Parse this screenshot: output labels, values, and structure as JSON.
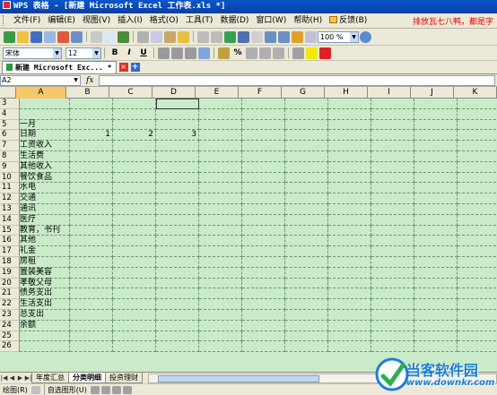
{
  "window": {
    "title": "WPS 表格 - [新建 Microsoft Excel 工作表.xls *]"
  },
  "menu": {
    "items": [
      "文件(F)",
      "编辑(E)",
      "视图(V)",
      "插入(I)",
      "格式(O)",
      "工具(T)",
      "数据(D)",
      "窗口(W)",
      "帮助(H)",
      "反馈(B)"
    ],
    "ad_text": "排放瓦七八鸭，都是字"
  },
  "toolbar": {
    "zoom": "100 %",
    "font_name": "宋体",
    "font_size": "12"
  },
  "doc_tab": {
    "label": "新建 Microsoft Exc... *"
  },
  "formula_bar": {
    "name_box": "A2",
    "fx": "fx"
  },
  "grid": {
    "columns": [
      "A",
      "B",
      "C",
      "D",
      "E",
      "F",
      "G",
      "H",
      "I",
      "J",
      "K"
    ],
    "selected_column": "A",
    "rows": [
      {
        "n": "3",
        "a": "",
        "b": "",
        "c": "",
        "d": ""
      },
      {
        "n": "4",
        "a": "",
        "b": "",
        "c": "",
        "d": ""
      },
      {
        "n": "5",
        "a": "一月",
        "b": "",
        "c": "",
        "d": ""
      },
      {
        "n": "6",
        "a": "日期",
        "b": "1",
        "c": "2",
        "d": "3"
      },
      {
        "n": "7",
        "a": "工资收入",
        "b": "",
        "c": "",
        "d": ""
      },
      {
        "n": "8",
        "a": "生活费",
        "b": "",
        "c": "",
        "d": ""
      },
      {
        "n": "9",
        "a": "其他收入",
        "b": "",
        "c": "",
        "d": ""
      },
      {
        "n": "10",
        "a": "餐饮食品",
        "b": "",
        "c": "",
        "d": ""
      },
      {
        "n": "11",
        "a": "水电",
        "b": "",
        "c": "",
        "d": ""
      },
      {
        "n": "12",
        "a": "交通",
        "b": "",
        "c": "",
        "d": ""
      },
      {
        "n": "13",
        "a": "通讯",
        "b": "",
        "c": "",
        "d": ""
      },
      {
        "n": "14",
        "a": "医疗",
        "b": "",
        "c": "",
        "d": ""
      },
      {
        "n": "15",
        "a": "教育，书刊",
        "b": "",
        "c": "",
        "d": ""
      },
      {
        "n": "16",
        "a": "其他",
        "b": "",
        "c": "",
        "d": ""
      },
      {
        "n": "17",
        "a": "礼金",
        "b": "",
        "c": "",
        "d": ""
      },
      {
        "n": "18",
        "a": "房租",
        "b": "",
        "c": "",
        "d": ""
      },
      {
        "n": "19",
        "a": "置装美容",
        "b": "",
        "c": "",
        "d": ""
      },
      {
        "n": "20",
        "a": "孝敬父母",
        "b": "",
        "c": "",
        "d": ""
      },
      {
        "n": "21",
        "a": "债务支出",
        "b": "",
        "c": "",
        "d": ""
      },
      {
        "n": "22",
        "a": "生活支出",
        "b": "",
        "c": "",
        "d": ""
      },
      {
        "n": "23",
        "a": "总支出",
        "b": "",
        "c": "",
        "d": ""
      },
      {
        "n": "24",
        "a": "余额",
        "b": "",
        "c": "",
        "d": ""
      },
      {
        "n": "25",
        "a": "",
        "b": "",
        "c": "",
        "d": ""
      },
      {
        "n": "26",
        "a": "",
        "b": "",
        "c": "",
        "d": ""
      }
    ]
  },
  "sheets": {
    "tabs": [
      "年度汇总",
      "分类明细",
      "投资理财"
    ],
    "active": "分类明细"
  },
  "drawbar": {
    "draw_label": "绘图(R)",
    "autoshape_label": "自选图形(U)"
  },
  "watermark": {
    "title": "当客软件园",
    "url": "www.downkr.com"
  },
  "colors": {
    "title_bar": "#0a56c8",
    "grid_bg": "#c9ebc9",
    "accent_red": "#d00000",
    "watermark_blue": "#1a7fd4"
  }
}
